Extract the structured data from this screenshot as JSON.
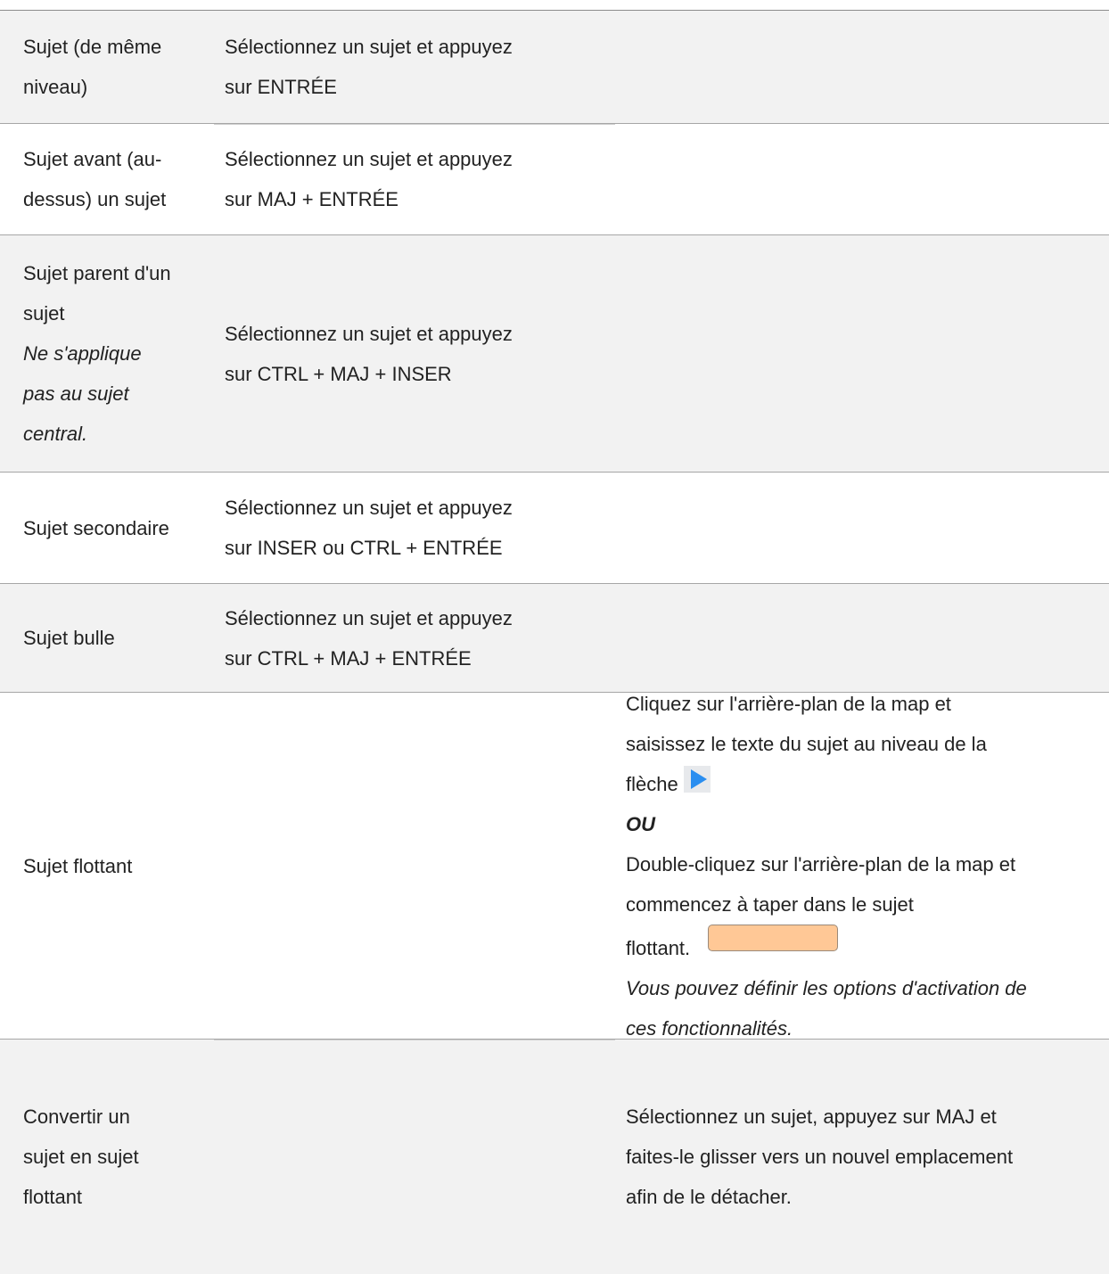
{
  "rows": [
    {
      "name_lines": [
        "Sujet (de même",
        "niveau)"
      ],
      "method_lines": [
        "Sélectionnez un sujet et appuyez",
        "sur ENTRÉE"
      ]
    },
    {
      "name_lines": [
        "Sujet avant (au-",
        "dessus) un sujet"
      ],
      "method_lines": [
        "Sélectionnez un sujet et appuyez",
        "sur MAJ + ENTRÉE"
      ]
    },
    {
      "name_lines": [
        "Sujet parent d'un",
        "sujet"
      ],
      "note_lines": [
        "Ne s'applique",
        "pas au sujet",
        "central."
      ],
      "method_lines": [
        "Sélectionnez un sujet et appuyez",
        "sur CTRL + MAJ + INSER"
      ]
    },
    {
      "name": "Sujet secondaire",
      "method_lines": [
        "Sélectionnez un sujet et appuyez",
        "sur INSER ou CTRL + ENTRÉE"
      ]
    },
    {
      "name": "Sujet bulle",
      "method_lines": [
        "Sélectionnez un sujet et appuyez",
        "sur CTRL + MAJ + ENTRÉE"
      ]
    },
    {
      "name": "Sujet flottant",
      "method_lines_a": [
        "Cliquez sur l'arrière-plan de la map et",
        "saisissez le texte du sujet au niveau de la"
      ],
      "arrow_prefix": "flèche",
      "or_text": "OU",
      "method_lines_b": [
        "Double-cliquez sur l'arrière-plan de la map et",
        "commencez à taper dans le sujet"
      ],
      "float_prefix": "flottant.",
      "note_lines": [
        "Vous pouvez définir les options d'activation de",
        "ces fonctionnalités."
      ],
      "arrow_icon": "blue-right-arrow",
      "float_swatch_color": "#ffc896"
    },
    {
      "name_lines": [
        "Convertir un",
        "sujet en sujet",
        "flottant"
      ],
      "method_lines": [
        "Sélectionnez un sujet, appuyez sur MAJ et",
        "faites-le glisser vers un nouvel emplacement",
        "afin de le détacher."
      ]
    }
  ]
}
